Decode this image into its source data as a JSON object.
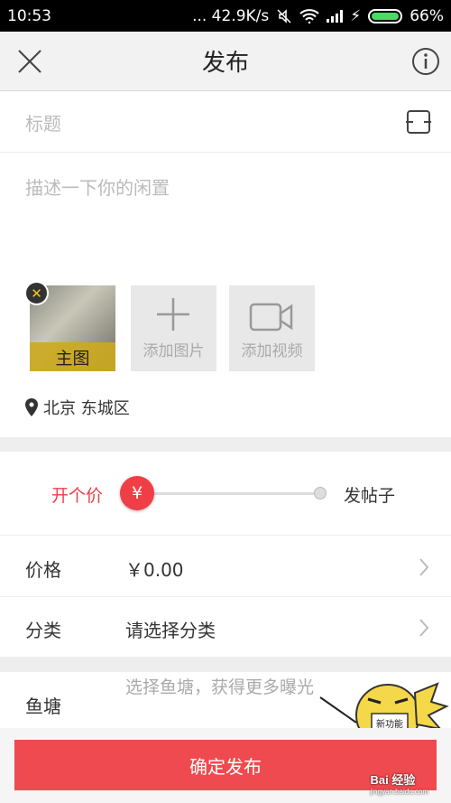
{
  "status_bar": {
    "time": "10:53",
    "network_speed": "... 42.9K/s",
    "battery": "66%"
  },
  "navbar": {
    "title": "发布",
    "close_icon": "close-icon",
    "info_icon": "info-icon"
  },
  "form": {
    "title_placeholder": "标题",
    "description_placeholder": "描述一下你的闲置",
    "media": {
      "main_label": "主图",
      "add_image_label": "添加图片",
      "add_video_label": "添加视频"
    },
    "location": "北京 东城区"
  },
  "price_mode": {
    "left_label": "开个价",
    "right_label": "发帖子",
    "knob_symbol": "¥"
  },
  "rows": {
    "price": {
      "label": "价格",
      "value": "￥0.00"
    },
    "category": {
      "label": "分类",
      "value": "请选择分类"
    },
    "pond": {
      "label": "鱼塘",
      "hint": "选择鱼塘，获得更多曝光",
      "badge": "新功能"
    }
  },
  "submit_label": "确定发布",
  "watermark": {
    "text": "Bai 经验",
    "url": "jingyan.baidu.com"
  },
  "colors": {
    "accent": "#ef3e45",
    "submit": "#ef4a4f",
    "nav_bg": "#f2f2f2",
    "separator": "#eeeeee"
  }
}
